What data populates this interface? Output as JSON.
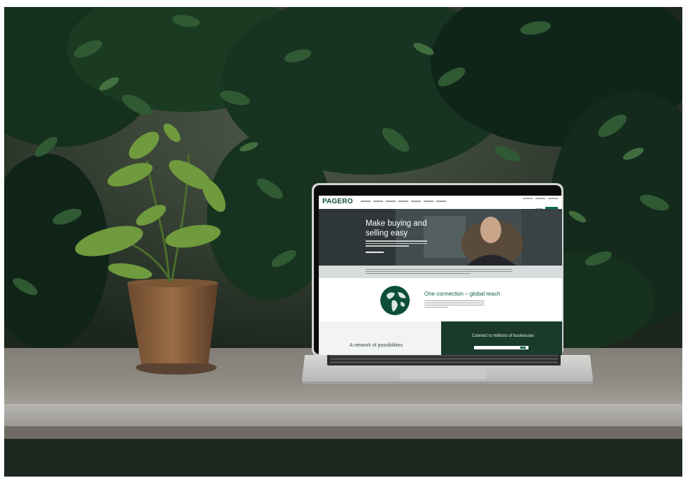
{
  "screen": {
    "logo": "PAGERO",
    "hero": {
      "title": "Make buying and selling easy"
    },
    "section": {
      "title": "One connection – global reach"
    },
    "bottom": {
      "left_title": "A network of possibilities",
      "right_title": "Connect to millions of businesses"
    }
  },
  "colors": {
    "brand": "#0d4f3a",
    "accent": "#0d6b4c",
    "hero_bg": "#3a4446",
    "dark_panel": "#1a3a2c"
  }
}
